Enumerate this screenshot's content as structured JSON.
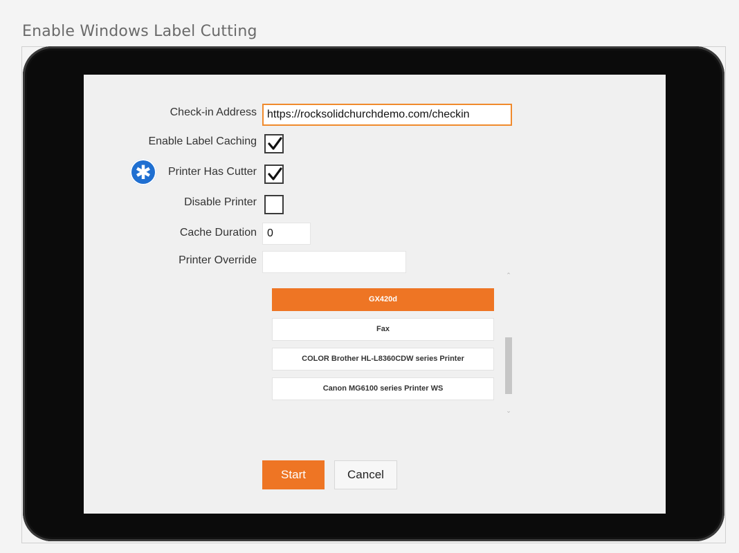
{
  "doc_title": "Enable Windows Label Cutting",
  "form": {
    "checkin_address": {
      "label": "Check-in Address",
      "value": "https://rocksolidchurchdemo.com/checkin"
    },
    "enable_label_caching": {
      "label": "Enable Label Caching",
      "checked": true
    },
    "printer_has_cutter": {
      "label": "Printer Has Cutter",
      "checked": true,
      "badge_icon": "asterisk-icon",
      "badge_glyph": "✱"
    },
    "disable_printer": {
      "label": "Disable Printer",
      "checked": false
    },
    "cache_duration": {
      "label": "Cache Duration",
      "value": "0"
    },
    "printer_override": {
      "label": "Printer Override",
      "value": ""
    }
  },
  "printer_list": {
    "items": [
      {
        "name": "GX420d",
        "selected": true
      },
      {
        "name": "Fax",
        "selected": false
      },
      {
        "name": "COLOR Brother HL-L8360CDW series Printer",
        "selected": false
      },
      {
        "name": "Canon MG6100 series Printer WS",
        "selected": false
      }
    ],
    "scroll_up_icon": "chevron-up-icon",
    "scroll_down_icon": "chevron-down-icon"
  },
  "buttons": {
    "start": "Start",
    "cancel": "Cancel"
  },
  "colors": {
    "accent": "#ee7524",
    "badge": "#1f6fd1",
    "screen_bg": "#f0f0f0",
    "tablet_bezel": "#0b0b0b"
  }
}
